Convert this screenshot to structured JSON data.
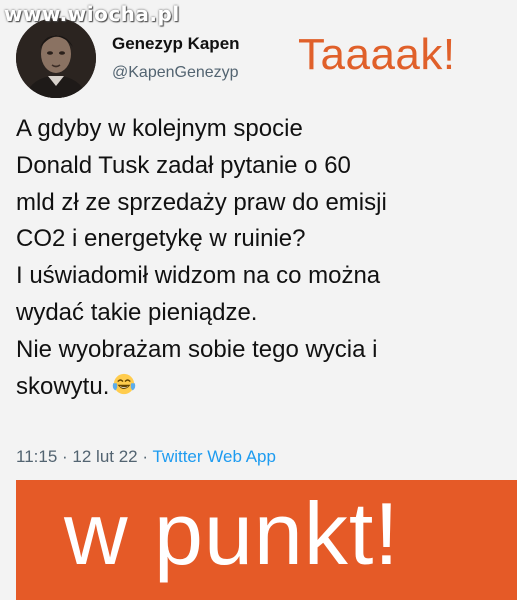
{
  "watermark": {
    "text": "www.wiocha.pl"
  },
  "tweet": {
    "display_name": "Genezyp Kapen",
    "handle": "@KapenGenezyp",
    "reaction": "Taaaak!",
    "body_lines": [
      "A gdyby w kolejnym spocie",
      "Donald Tusk zadał pytanie o 60",
      "mld zł ze sprzedaży praw do emisji",
      "CO2 i energetykę w ruinie?",
      "I uświadomił widzom na co można",
      "wydać takie pieniądze.",
      "Nie wyobrażam sobie tego wycia i",
      "skowytu."
    ],
    "emoji": "face-with-tears-of-joy-icon",
    "time": "11:15",
    "separator": "·",
    "date": "12 lut 22",
    "client": "Twitter Web App"
  },
  "banner": {
    "text": "w punkt!",
    "color": "#e55a27"
  },
  "colors": {
    "reaction": "#e0602a",
    "link": "#1d9bf0",
    "muted": "#536471",
    "background": "#f3f3f3"
  }
}
